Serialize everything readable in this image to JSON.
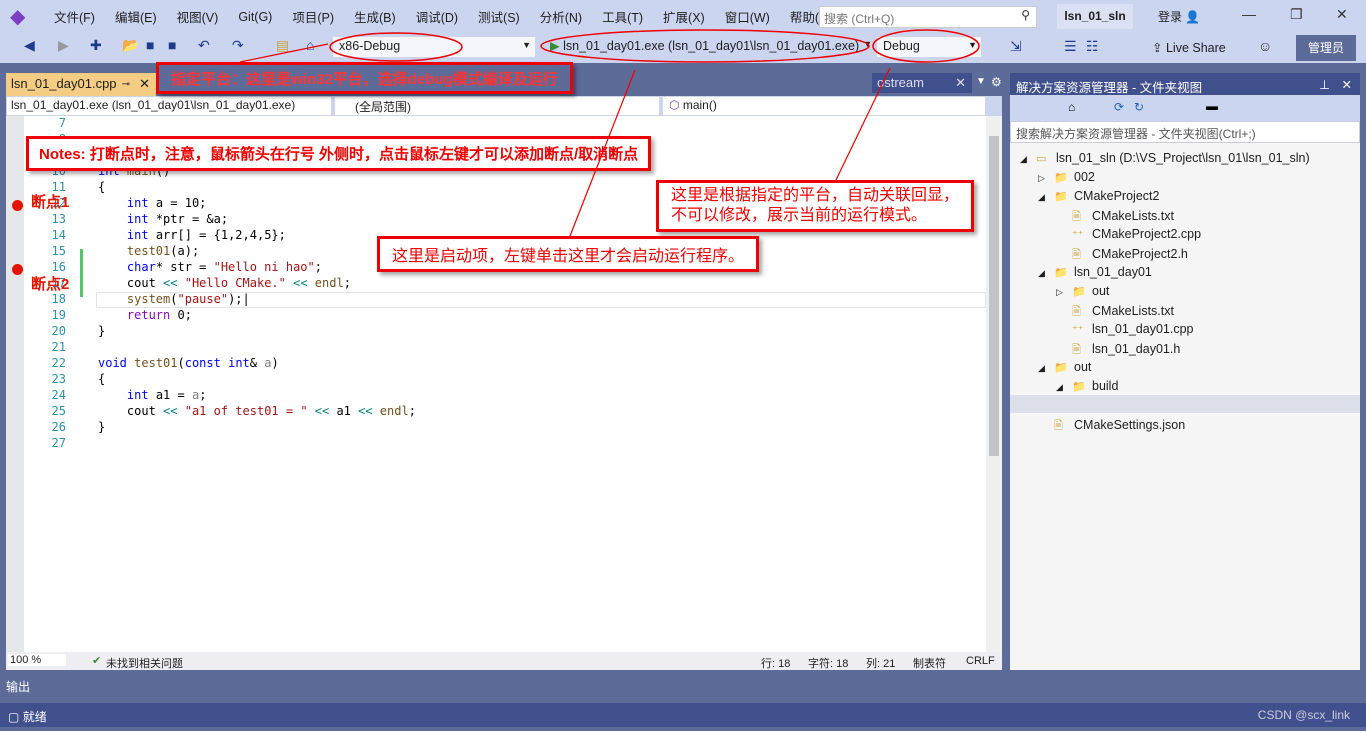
{
  "menubar": {
    "items": [
      "文件(F)",
      "编辑(E)",
      "视图(V)",
      "Git(G)",
      "项目(P)",
      "生成(B)",
      "调试(D)",
      "测试(S)",
      "分析(N)",
      "工具(T)",
      "扩展(X)",
      "窗口(W)",
      "帮助(H)"
    ],
    "search_placeholder": "搜索 (Ctrl+Q)",
    "solution": "lsn_01_sln",
    "login": "登录"
  },
  "toolbar": {
    "config": "x86-Debug",
    "startup": "lsn_01_day01.exe (lsn_01_day01\\lsn_01_day01.exe)",
    "mode": "Debug",
    "live_share": "Live Share",
    "admin": "管理员"
  },
  "tabs": {
    "doc": "lsn_01_day01.cpp",
    "ostream": "ostream"
  },
  "navbar": {
    "project": "lsn_01_day01.exe (lsn_01_day01\\lsn_01_day01.exe)",
    "scope": "(全局范围)",
    "member": "main()"
  },
  "code": {
    "lines": [
      "7",
      "8",
      "9",
      "10",
      "11",
      "12",
      "13",
      "14",
      "15",
      "16",
      "17",
      "18",
      "19",
      "20",
      "21",
      "22",
      "23",
      "24",
      "25",
      "26",
      "27"
    ]
  },
  "breakpoints": {
    "bp1": "断点1",
    "bp2": "断点2"
  },
  "editor_status": {
    "zoom": "100 %",
    "issues": "未找到相关问题",
    "line": "行: 18",
    "char": "字符: 18",
    "col": "列: 21",
    "tabs": "制表符",
    "eol": "CRLF"
  },
  "solution_explorer": {
    "title": "解决方案资源管理器 - 文件夹视图",
    "search": "搜索解决方案资源管理器 - 文件夹视图(Ctrl+;)",
    "items": [
      "lsn_01_sln (D:\\VS_Project\\lsn_01\\lsn_01_sln)",
      "002",
      "CMakeProject2",
      "CMakeLists.txt",
      "CMakeProject2.cpp",
      "CMakeProject2.h",
      "lsn_01_day01",
      "out",
      "CMakeLists.txt",
      "lsn_01_day01.cpp",
      "lsn_01_day01.h",
      "out",
      "build",
      "CMakeLists.txt",
      "CMakeSettings.json"
    ]
  },
  "output": {
    "label": "输出"
  },
  "statusbar": {
    "ready": "就绪",
    "watermark": "CSDN @scx_link"
  },
  "annotations": {
    "platform": "指定平台：这里是win32平台，选择debug模式编译及运行",
    "notes": "Notes: 打断点时，注意，鼠标箭头在行号 外侧时，点击鼠标左键才可以添加断点/取消断点",
    "mode": "这里是根据指定的平台，自动关联回显，\n不可以修改，展示当前的运行模式。",
    "startup": "这里是启动项，左键单击这里才会启动运行程序。"
  },
  "colors": {
    "chrome": "#ccd5f0",
    "panel": "#5d6b99",
    "statusbar": "#40508d",
    "active_tab": "#f5cc84",
    "annotation": "#e00000"
  }
}
